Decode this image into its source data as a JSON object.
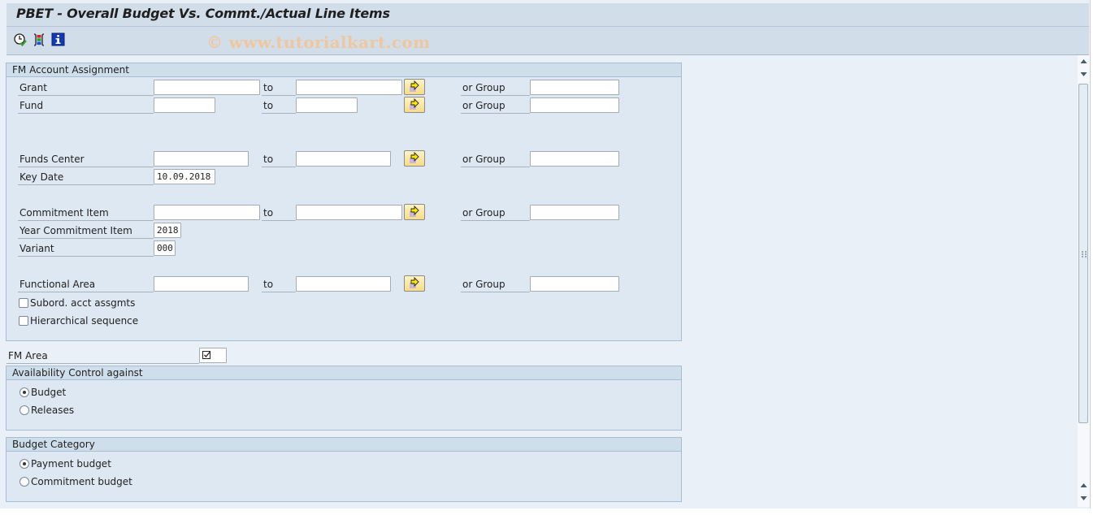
{
  "window": {
    "title": "PBET - Overall Budget Vs. Commt./Actual Line Items"
  },
  "toolbar": {
    "icons": [
      {
        "name": "execute-clock-icon",
        "tooltip": "Execute and Print"
      },
      {
        "name": "selection-options-icon",
        "tooltip": "Selection Options"
      },
      {
        "name": "info-icon",
        "tooltip": "Program Documentation"
      }
    ],
    "watermark": "© www.tutorialkart.com"
  },
  "fm_account_assignment": {
    "header": "FM Account Assignment",
    "to_label": "to",
    "or_group_label": "or Group",
    "rows": {
      "grant": {
        "label": "Grant",
        "from": "",
        "to": "",
        "group": ""
      },
      "fund": {
        "label": "Fund",
        "from": "",
        "to": "",
        "group": ""
      },
      "funds_center": {
        "label": "Funds Center",
        "from": "",
        "to": "",
        "group": ""
      },
      "key_date": {
        "label": "Key Date",
        "value": "10.09.2018"
      },
      "commitment_item": {
        "label": "Commitment Item",
        "from": "",
        "to": "",
        "group": ""
      },
      "year_commitment_item": {
        "label": "Year Commitment Item",
        "value": "2018"
      },
      "variant": {
        "label": "Variant",
        "value": "000"
      },
      "functional_area": {
        "label": "Functional Area",
        "from": "",
        "to": "",
        "group": ""
      }
    },
    "checkboxes": {
      "subord": {
        "label": "Subord. acct assgmts",
        "checked": false
      },
      "hierarchical": {
        "label": "Hierarchical sequence",
        "checked": false
      }
    }
  },
  "fm_area": {
    "label": "FM Area",
    "value": "☑"
  },
  "availability_control": {
    "header": "Availability Control against",
    "options": [
      {
        "label": "Budget",
        "selected": true
      },
      {
        "label": "Releases",
        "selected": false
      }
    ]
  },
  "budget_category": {
    "header": "Budget Category",
    "options": [
      {
        "label": "Payment budget",
        "selected": true
      },
      {
        "label": "Commitment budget",
        "selected": false
      }
    ]
  }
}
